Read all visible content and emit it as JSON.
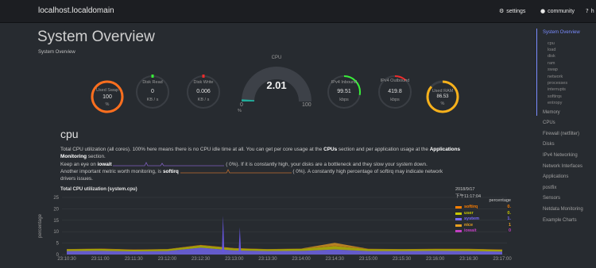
{
  "header": {
    "brand": "localhost.localdomain",
    "links": [
      {
        "icon": "gear-icon",
        "label": "settings"
      },
      {
        "icon": "github-icon",
        "label": "community"
      },
      {
        "icon": "question-icon",
        "label": "h"
      }
    ]
  },
  "page": {
    "title": "System Overview",
    "subtitle": "System Overview"
  },
  "gauges": [
    {
      "label": "Used Swap",
      "value": "100",
      "unit": "%",
      "fraction": 1.0,
      "color": "#ff6f1e"
    },
    {
      "label": "Disk Read",
      "value": "0",
      "unit": "KB / s",
      "fraction": 0.0,
      "color": "#38ef38"
    },
    {
      "label": "Disk Write",
      "value": "0.006",
      "unit": "KB / s",
      "fraction": 0.0,
      "color": "#ef2b2b"
    },
    {
      "label": "CPU",
      "value": "2.01",
      "min": "0",
      "max": "100",
      "unit": "%",
      "fraction": 0.0201,
      "color": "#22aa99"
    },
    {
      "label": "IPv4 Inbound",
      "value": "99.51",
      "unit": "kbps",
      "fraction": 0.28,
      "color": "#38ef38"
    },
    {
      "label": "IPv4 Outbound",
      "value": "419.8",
      "unit": "kbps",
      "fraction": 0.12,
      "color": "#ef2b2b"
    },
    {
      "label": "Used RAM",
      "value": "86.53",
      "unit": "%",
      "fraction": 0.8653,
      "color": "#f7b11b"
    }
  ],
  "cpu_section": {
    "title": "cpu",
    "intro_a": "Total CPU utilization (all cores). 100% here means there is no CPU idle time at all. You can get per core usage at the ",
    "intro_cpus": "CPUs",
    "intro_b": " section and per application usage at the ",
    "intro_apps": "Applications",
    "intro_monitoring": "Monitoring",
    "intro_c": " section.",
    "iowait_a": "Keep an eye on ",
    "iowait_b": "iowait",
    "iowait_c": "0%",
    "iowait_d": "). If it is constantly high, your disks are a bottleneck and they slow your system down.",
    "softirq_a": "Another important metric worth monitoring, is ",
    "softirq_b": "softirq",
    "softirq_c": "0%",
    "softirq_d": "). A constantly high percentage of softirq may indicate network",
    "softirq_e": "drivers issues."
  },
  "chart_meta": {
    "title": "Total CPU utilization (system.cpu)",
    "date": "2018/9/17",
    "time": "下午11:17:04",
    "unit_label": "percentage",
    "colors": {
      "softirq": "#ff7f00",
      "user": "#c8c800",
      "system": "#7a6cff",
      "nice": "#e8a020",
      "iowait": "#c040c0",
      "spikes": "#6655dd"
    }
  },
  "chart_data": {
    "type": "area",
    "ylabel": "percentage",
    "ylim": [
      0,
      25
    ],
    "yticks": [
      0,
      5,
      10,
      15,
      20,
      25
    ],
    "x": [
      "23:10:30",
      "23:11:00",
      "23:11:30",
      "23:12:00",
      "23:12:30",
      "23:13:00",
      "23:13:30",
      "23:14:00",
      "23:14:30",
      "23:15:00",
      "23:15:30",
      "23:16:00",
      "23:16:30",
      "23:17:00"
    ],
    "series": [
      {
        "name": "softirq",
        "values": [
          0.1,
          0.1,
          0.1,
          0.1,
          0.2,
          0.1,
          0.1,
          0.1,
          0.2,
          0.1,
          0.1,
          0.1,
          0.1,
          0.1
        ],
        "legend_value": "0."
      },
      {
        "name": "user",
        "values": [
          0.8,
          0.9,
          0.7,
          0.8,
          1.0,
          0.9,
          0.8,
          0.9,
          1.5,
          0.9,
          0.8,
          0.8,
          0.9,
          0.8
        ],
        "legend_value": "0."
      },
      {
        "name": "system",
        "values": [
          1.5,
          1.6,
          1.4,
          1.5,
          3.0,
          1.8,
          1.5,
          1.6,
          2.2,
          1.5,
          1.5,
          1.6,
          1.5,
          1.3
        ],
        "legend_value": "1."
      },
      {
        "name": "nice",
        "values": [
          0.0,
          0.0,
          0.0,
          0.0,
          0.0,
          0.0,
          0.0,
          0.0,
          1.2,
          0.0,
          0.0,
          0.0,
          0.0,
          0.0
        ],
        "legend_value": "1"
      },
      {
        "name": "iowait",
        "values": [
          0.0,
          0.0,
          0.0,
          0.0,
          0.0,
          0.0,
          0.0,
          0.0,
          0.0,
          0.0,
          0.0,
          0.0,
          0.0,
          0.0
        ],
        "legend_value": "0"
      }
    ],
    "spikes": [
      {
        "x": "23:12:50",
        "value": 17
      },
      {
        "x": "23:13:05",
        "value": 12
      }
    ]
  },
  "sidenav": {
    "items": [
      {
        "label": "System Overview",
        "level": 0,
        "active": true
      },
      {
        "label": "cpu",
        "level": 1
      },
      {
        "label": "load",
        "level": 1
      },
      {
        "label": "disk",
        "level": 1
      },
      {
        "label": "ram",
        "level": 1
      },
      {
        "label": "swap",
        "level": 1
      },
      {
        "label": "network",
        "level": 1
      },
      {
        "label": "processes",
        "level": 1
      },
      {
        "label": "interrupts",
        "level": 1
      },
      {
        "label": "softirqs",
        "level": 1
      },
      {
        "label": "entropy",
        "level": 1
      },
      {
        "label": "Memory",
        "level": 0
      },
      {
        "label": "CPUs",
        "level": 0
      },
      {
        "label": "Firewall (netfilter)",
        "level": 0
      },
      {
        "label": "Disks",
        "level": 0
      },
      {
        "label": "IPv4 Networking",
        "level": 0
      },
      {
        "label": "Network Interfaces",
        "level": 0
      },
      {
        "label": "Applications",
        "level": 0
      },
      {
        "label": "postfix",
        "level": 0
      },
      {
        "label": "Sensors",
        "level": 0
      },
      {
        "label": "Netdata Monitoring",
        "level": 0
      },
      {
        "label": "Example Charts",
        "level": 0
      }
    ]
  }
}
